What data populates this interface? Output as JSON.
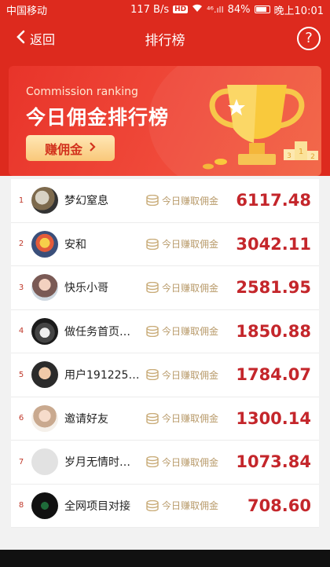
{
  "status_bar": {
    "carrier": "中国移动",
    "net_speed": "117 B/s",
    "hd": "HD",
    "signal": "⁴⁶.ıll",
    "battery": "84%",
    "time": "晚上10:01"
  },
  "navbar": {
    "back_label": "返回",
    "title": "排行榜",
    "help_label": "?"
  },
  "banner": {
    "subtitle_en": "Commission ranking",
    "title_cn": "今日佣金排行榜",
    "button_label": "赚佣金",
    "trophy_badges": [
      "1",
      "2",
      "3"
    ]
  },
  "colors": {
    "brand_red": "#dd2a1e",
    "amount_red": "#c4262b",
    "tag_gold": "#b89a6a"
  },
  "ranking": {
    "tag_text": "今日赚取佣金",
    "rows": [
      {
        "rank": "1",
        "name": "梦幻窒息",
        "amount": "6117.48",
        "avatar": "bird"
      },
      {
        "rank": "2",
        "name": "安和",
        "amount": "3042.11",
        "avatar": "cartoon"
      },
      {
        "rank": "3",
        "name": "快乐小哥",
        "amount": "2581.95",
        "avatar": "child"
      },
      {
        "rank": "4",
        "name": "做任务首页…",
        "amount": "1850.88",
        "avatar": "car"
      },
      {
        "rank": "5",
        "name": "用户191225…",
        "amount": "1784.07",
        "avatar": "face"
      },
      {
        "rank": "6",
        "name": "邀请好友",
        "amount": "1300.14",
        "avatar": "girl"
      },
      {
        "rank": "7",
        "name": "岁月无情时…",
        "amount": "1073.84",
        "avatar": "default-user"
      },
      {
        "rank": "8",
        "name": "全网项目对接",
        "amount": "708.60",
        "avatar": "dark-logo"
      }
    ]
  }
}
